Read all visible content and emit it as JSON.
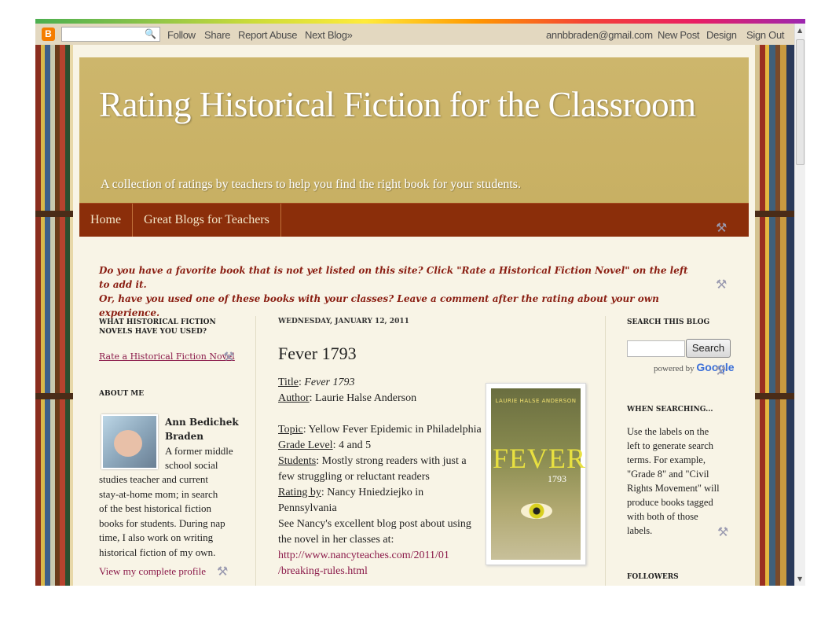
{
  "navbar": {
    "logo": "B",
    "links": [
      "Follow",
      "Share",
      "Report Abuse",
      "Next Blog»"
    ],
    "account": "annbbraden@gmail.com",
    "right_links": [
      "New Post",
      "Design",
      "Sign Out"
    ]
  },
  "blog": {
    "title": "Rating Historical Fiction for the Classroom",
    "description": "A collection of ratings by teachers to help you find the right book for your students."
  },
  "tabs": [
    "Home",
    "Great Blogs for Teachers"
  ],
  "notice": {
    "line1": "Do you have a favorite book that is not yet listed on this site? Click \"Rate a Historical Fiction Novel\" on the left to add it.",
    "line2": "Or, have you used one of these books with your classes? Leave a comment after the rating about your own experience."
  },
  "left": {
    "novels_title": "WHAT HISTORICAL FICTION NOVELS HAVE YOU USED?",
    "rate_link": "Rate a Historical Fiction Novel",
    "about_title": "ABOUT ME",
    "name": "Ann Bedichek Braden",
    "bio_lines": [
      "A former middle",
      "school social",
      "studies teacher and current",
      "stay-at-home mom; in search",
      "of the best historical fiction",
      "books for students. During nap",
      "time, I also work on writing",
      "historical fiction of my own."
    ],
    "profile_link": "View my complete profile"
  },
  "post": {
    "date": "WEDNESDAY, JANUARY 12, 2011",
    "title": "Fever 1793",
    "title_label": "Title",
    "title_value": "Fever 1793",
    "author_label": "Author",
    "author_value": ": Laurie Halse Anderson",
    "topic_label": "Topic",
    "topic_value": ": Yellow Fever Epidemic in Philadelphia",
    "grade_label": "Grade Level",
    "grade_value": ": 4 and 5",
    "students_label": "Students",
    "students_value1": ":  Mostly strong readers with just a",
    "students_value2": "few struggling or reluctant readers",
    "rating_label": "Rating by",
    "rating_value1": ": Nancy Hniedziejko in",
    "rating_value2": "Pennsylvania",
    "see_line1": "See Nancy's excellent blog post about using",
    "see_line2": "the novel in her classes at:",
    "url_line1": "http://www.nancyteaches.com/2011/01",
    "url_line2": "/breaking-rules.html",
    "cover": {
      "author": "LAURIE HALSE ANDERSON",
      "title": "FEVER",
      "year": "1793"
    }
  },
  "right": {
    "search_title": "SEARCH THIS BLOG",
    "search_button": "Search",
    "powered_by": "powered by",
    "google": "Google",
    "searching_title": "WHEN SEARCHING...",
    "searching_lines": [
      "Use the labels on the",
      "left to generate search",
      "terms. For example,",
      "\"Grade 8\" and \"Civil",
      "Rights Movement\" will",
      "produce books tagged",
      "with both of those",
      "labels."
    ],
    "followers_title": "FOLLOWERS"
  }
}
